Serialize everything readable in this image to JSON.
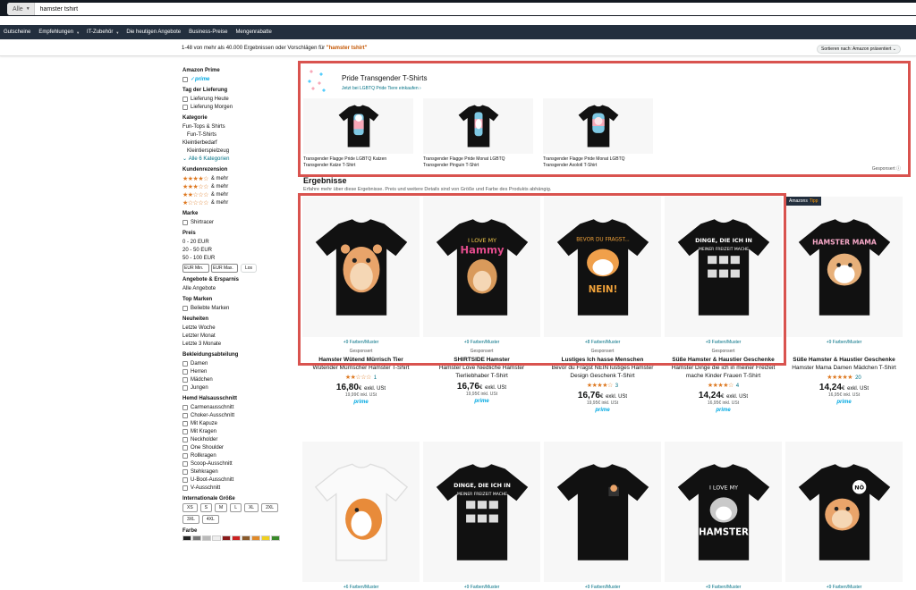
{
  "search": {
    "department": "Alle",
    "query": "hamster tshirt"
  },
  "nav": [
    "Gutscheine",
    "Empfehlungen",
    "IT-Zubehör",
    "Die heutigen Angebote",
    "Business-Preise",
    "Mengenrabatte"
  ],
  "results": {
    "count_text": "1-48 von mehr als 40.000 Ergebnissen oder Vorschlägen für",
    "query_quoted": "\"hamster tshirt\"",
    "sort_label": "Sortieren nach: Amazon präsentiert"
  },
  "sidebar": {
    "prime_heading": "Amazon Prime",
    "prime_label": "prime",
    "delivery_heading": "Tag der Lieferung",
    "delivery_today": "Lieferung Heute",
    "delivery_tomorrow": "Lieferung Morgen",
    "category_heading": "Kategorie",
    "categories": [
      "Fun-Tops & Shirts",
      "Fun-T-Shirts",
      "Kleintierbedarf",
      "Kleintierspielzeug"
    ],
    "all_categories": "Alle 6 Kategorien",
    "review_heading": "Kundenrezension",
    "review_rows": [
      {
        "stars": "★★★★☆",
        "label": "& mehr"
      },
      {
        "stars": "★★★☆☆",
        "label": "& mehr"
      },
      {
        "stars": "★★☆☆☆",
        "label": "& mehr"
      },
      {
        "stars": "★☆☆☆☆",
        "label": "& mehr"
      }
    ],
    "brand_heading": "Marke",
    "brand_item": "Shirtracer",
    "price_heading": "Preis",
    "prices": [
      "0 - 20 EUR",
      "20 - 50 EUR",
      "50 - 100 EUR"
    ],
    "price_min_placeholder": "EUR Min.",
    "price_max_placeholder": "EUR Max.",
    "price_go": "Los",
    "deals_heading": "Angebote & Ersparnis",
    "deals_item": "Alle Angebote",
    "topbrands_heading": "Top Marken",
    "topbrands_item": "Beliebte Marken",
    "new_heading": "Neuheiten",
    "new_items": [
      "Letzte Woche",
      "Letzter Monat",
      "Letzte 3 Monate"
    ],
    "dept_heading": "Bekleidungsabteilung",
    "dept_items": [
      "Damen",
      "Herren",
      "Mädchen",
      "Jungen"
    ],
    "neck_heading": "Hemd Halsausschnitt",
    "neck_items": [
      "Carmenausschnitt",
      "Choker-Ausschnitt",
      "Mit Kapuze",
      "Mit Kragen",
      "Neckholder",
      "One Shoulder",
      "Rollkragen",
      "Scoop-Ausschnitt",
      "Stehkragen",
      "U-Boot-Ausschnitt",
      "V-Ausschnitt"
    ],
    "size_heading": "Internationale Größe",
    "sizes": [
      "XS",
      "S",
      "M",
      "L",
      "XL",
      "2XL",
      "3XL",
      "4XL"
    ],
    "color_heading": "Farbe",
    "swatch_colors": [
      "#222222",
      "#777777",
      "#bbbbbb",
      "#eeeeee",
      "#8b1a1a",
      "#cc2222",
      "#8a5a2b",
      "#e08a2a",
      "#f0d020",
      "#3a8a2a"
    ]
  },
  "sponsored": {
    "title": "Pride Transgender T-Shirts",
    "link": "Jetzt bei LGBTQ Pride Tiere einkaufen ›",
    "footer": "Gesponsert",
    "items": [
      {
        "caption1": "Transgender Flagge Pride LGBTQ Katzen",
        "caption2": "Transgender Katze T-Shirt"
      },
      {
        "caption1": "Transgender Flagge Pride Monat LGBTQ",
        "caption2": "Transgender Pinguin T-Shirt"
      },
      {
        "caption1": "Transgender Flagge Pride Monat LGBTQ",
        "caption2": "Transgender Axolotl T-Shirt"
      }
    ]
  },
  "ergebnisse": {
    "title": "Ergebnisse",
    "subtitle": "Erfahre mehr über diese Ergebnisse. Preis und weitere Details sind von Größe und Farbe des Produkts abhängig."
  },
  "badge": {
    "prefix": "Amazons",
    "highlight": "Tipp"
  },
  "products": [
    {
      "colors": "+9 Farben/Muster",
      "sponsored": "Gesponsert",
      "brand": "Hamster Wütend Mürrisch Tier",
      "title": "Wütender Mürrischer Hamster T-Shirt",
      "stars": "★★☆☆☆",
      "count": "1",
      "price": "16,80",
      "unit": "€",
      "tax": "exkl. USt",
      "old": "19,99€ inkl. USt",
      "prime": "prime"
    },
    {
      "colors": "+9 Farben/Muster",
      "sponsored": "Gesponsert",
      "brand": "SHIRTSIDE Hamster",
      "title": "Hamster Love Niedliche Hamster Tierliebhaber T-Shirt",
      "stars": "",
      "count": "",
      "price": "16,76",
      "unit": "€",
      "tax": "exkl. USt",
      "old": "19,95€ inkl. USt",
      "prime": "prime"
    },
    {
      "colors": "+8 Farben/Muster",
      "sponsored": "Gesponsert",
      "brand": "Lustiges Ich hasse Menschen",
      "title": "Bevor du Fragst NEIN lustiges Hamster Design Geschenk T-Shirt",
      "stars": "★★★★☆",
      "count": "3",
      "price": "16,76",
      "unit": "€",
      "tax": "exkl. USt",
      "old": "19,95€ inkl. USt",
      "prime": "prime"
    },
    {
      "colors": "+9 Farben/Muster",
      "sponsored": "Gesponsert",
      "brand": "Süße Hamster & Haustier Geschenke",
      "title": "Hamster Dinge die ich in meiner Freizeit mache Kinder Frauen T-Shirt",
      "stars": "★★★★☆",
      "count": "4",
      "price": "14,24",
      "unit": "€",
      "tax": "exkl. USt",
      "old": "16,95€ inkl. USt",
      "prime": "prime"
    },
    {
      "colors": "+9 Farben/Muster",
      "sponsored": "",
      "brand": "Süße Hamster & Haustier Geschenke",
      "title": "Hamster Mama Damen Mädchen T-Shirt",
      "stars": "★★★★★",
      "count": "20",
      "price": "14,24",
      "unit": "€",
      "tax": "exkl. USt",
      "old": "16,95€ inkl. USt",
      "prime": "prime"
    }
  ],
  "row2_colors": [
    "+6 Farben/Muster",
    "+9 Farben/Muster",
    "+9 Farben/Muster",
    "+9 Farben/Muster",
    "+9 Farben/Muster"
  ],
  "shirt_texts": {
    "p2_top": "I LOVE MY",
    "p2_main": "Hammy",
    "p3_top": "BEVOR DU FRAGST...",
    "p3_main": "NEIN!",
    "p4_top": "DINGE, DIE ICH IN",
    "p4_main": "MEINER FREIZEIT MACHE",
    "p5_top": "HAMSTER MAMA",
    "r2_2_top": "DINGE, DIE ICH IN",
    "r2_2_main": "MEINER FREIZEIT MACHE",
    "r2_4_top": "I LOVE MY",
    "r2_4_main": "HAMSTER",
    "r2_5_bubble": "NÖ"
  }
}
